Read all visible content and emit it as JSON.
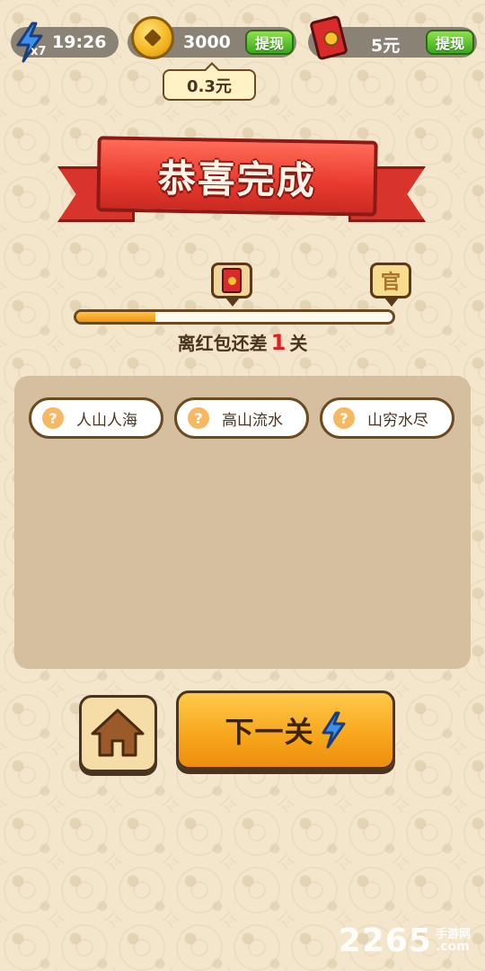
{
  "top_bar": {
    "energy": {
      "multiplier": "x7",
      "time": "19:26",
      "icon": "lightning-bolt-icon"
    },
    "coins": {
      "amount": "3000",
      "withdraw_label": "提现",
      "icon": "gold-coin-icon"
    },
    "red_packet": {
      "amount": "5元",
      "withdraw_label": "提现",
      "icon": "red-packet-icon"
    },
    "coin_tooltip": "0.3元"
  },
  "banner": {
    "title": "恭喜完成"
  },
  "progress": {
    "prefix": "离红包还差",
    "remaining": "1",
    "suffix": "关",
    "fill_fraction": 0.25,
    "milestone_left_icon": "red-packet-icon",
    "milestone_right_icon": "official-badge-icon",
    "milestone_right_glyph": "官"
  },
  "idioms": [
    {
      "hint": "?",
      "text": "人山人海"
    },
    {
      "hint": "?",
      "text": "高山流水"
    },
    {
      "hint": "?",
      "text": "山穷水尽"
    }
  ],
  "buttons": {
    "home_icon": "house-icon",
    "next_label": "下一关",
    "next_icon": "lightning-bolt-icon"
  },
  "watermark": {
    "number": "2265",
    "cn": "手游网",
    "suffix": ".com"
  },
  "colors": {
    "background": "#f3e6cc",
    "ribbon": "#e8392e",
    "withdraw_green": "#3aa61d",
    "progress_orange": "#f09414",
    "highlight_red": "#e02020",
    "next_button": "#f7a51b",
    "panel": "#d5bf9e"
  }
}
